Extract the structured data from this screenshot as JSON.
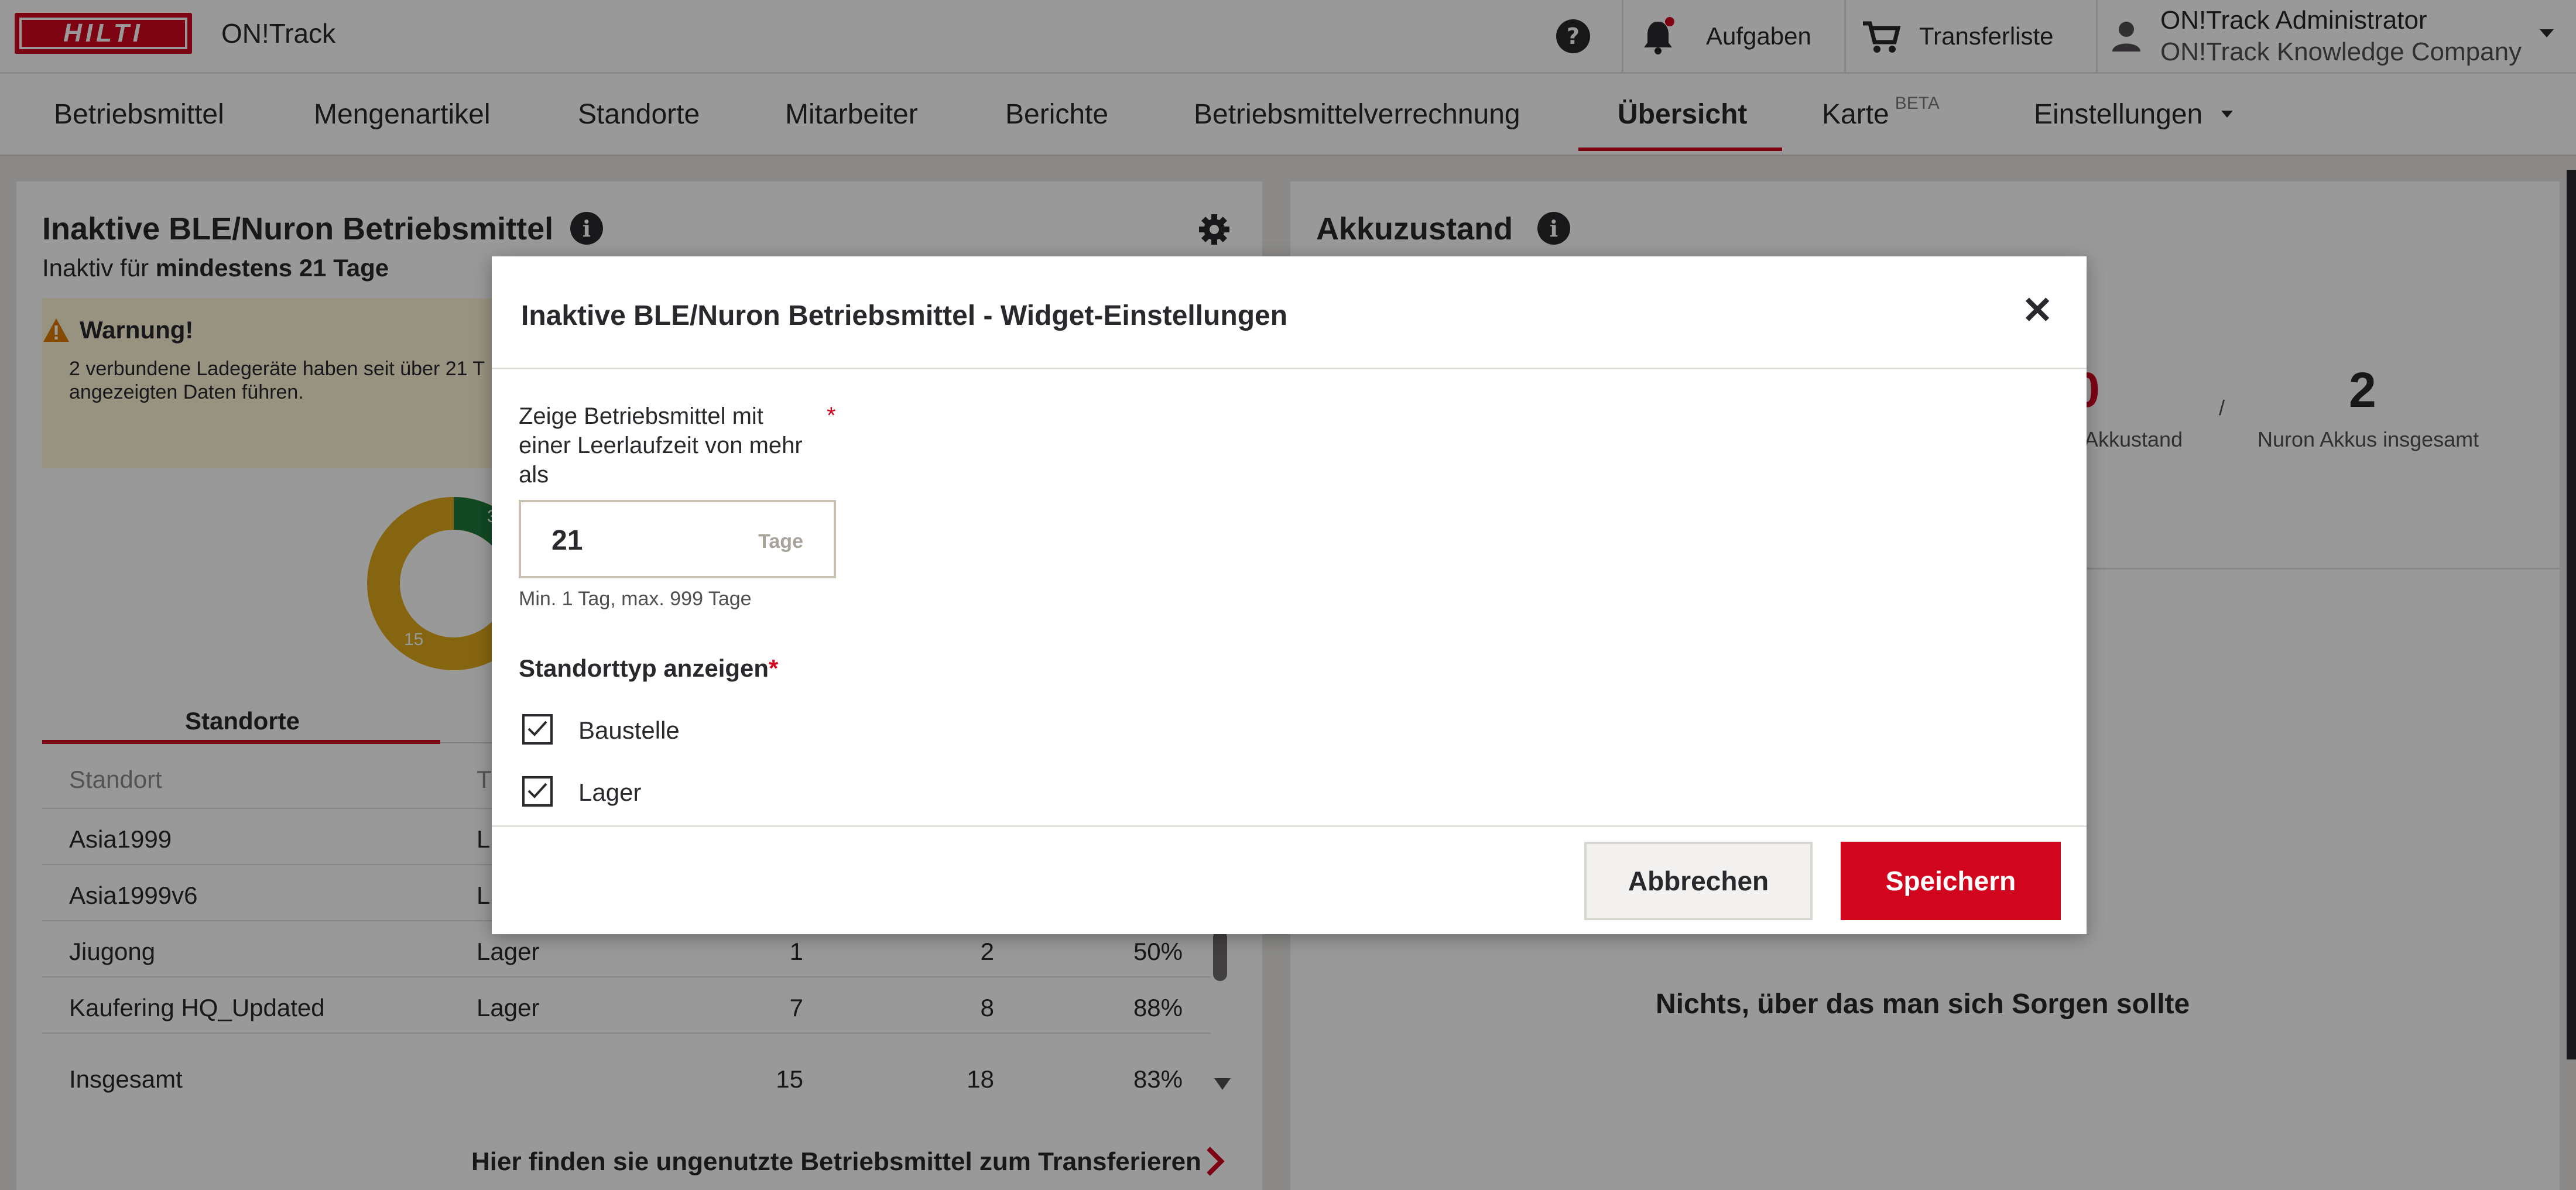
{
  "header": {
    "brand": "HILTI",
    "app_name": "ON!Track",
    "help_icon": "question-circle-icon",
    "notifications_icon": "bell-icon",
    "tasks_label": "Aufgaben",
    "transfer_label": "Transferliste",
    "user_name": "ON!Track Administrator",
    "user_company": "ON!Track Knowledge Company"
  },
  "nav": {
    "items": [
      "Betriebsmittel",
      "Mengenartikel",
      "Standorte",
      "Mitarbeiter",
      "Berichte",
      "Betriebsmittelverrechnung",
      "Übersicht",
      "Karte",
      "Einstellungen"
    ],
    "beta_label": "BETA",
    "active": "Übersicht"
  },
  "left_widget": {
    "title": "Inaktive BLE/Nuron Betriebsmittel",
    "subtitle_prefix": "Inaktiv für ",
    "subtitle_bold": "mindestens 21 Tage",
    "warning_title": "Warnung!",
    "warning_text": "2 verbundene Ladegeräte haben seit über 21 T",
    "warning_text_2": "angezeigten Daten führen.",
    "donut_labels": [
      "3",
      "15"
    ],
    "tab_label": "Standorte",
    "columns": [
      "Standort",
      "T"
    ],
    "rows": [
      {
        "standort": "Asia1999",
        "typ": "L",
        "a": "",
        "b": "",
        "pct": ""
      },
      {
        "standort": "Asia1999v6",
        "typ": "L",
        "a": "",
        "b": "",
        "pct": ""
      },
      {
        "standort": "Jiugong",
        "typ": "Lager",
        "a": "1",
        "b": "2",
        "pct": "50%"
      },
      {
        "standort": "Kaufering HQ_Updated",
        "typ": "Lager",
        "a": "7",
        "b": "8",
        "pct": "88%"
      }
    ],
    "total": {
      "label": "Insgesamt",
      "a": "15",
      "b": "18",
      "pct": "83%"
    },
    "link": "Hier finden sie ungenutzte Betriebsmittel zum Transferieren"
  },
  "right_widget": {
    "title": "Akkuzustand",
    "value_left": "0",
    "label_left": "Akkustand",
    "separator": "/",
    "value_right": "2",
    "label_right": "Nuron Akkus insgesamt",
    "empty_message": "Nichts, über das man sich Sorgen sollte"
  },
  "modal": {
    "title": "Inaktive BLE/Nuron Betriebsmittel - Widget-Einstellungen",
    "idle_label": "Zeige Betriebsmittel mit einer Leerlaufzeit von mehr als",
    "idle_value": "21",
    "idle_unit": "Tage",
    "idle_hint": "Min. 1 Tag, max. 999 Tage",
    "location_type_label": "Standorttyp anzeigen",
    "options": [
      {
        "label": "Baustelle",
        "checked": true
      },
      {
        "label": "Lager",
        "checked": true
      }
    ],
    "cancel_label": "Abbrechen",
    "save_label": "Speichern"
  },
  "colors": {
    "brand_red": "#d2051e",
    "donut_green": "#1f7a3c",
    "donut_yellow": "#e0a81c",
    "warning_bg": "#fdf3d6"
  }
}
